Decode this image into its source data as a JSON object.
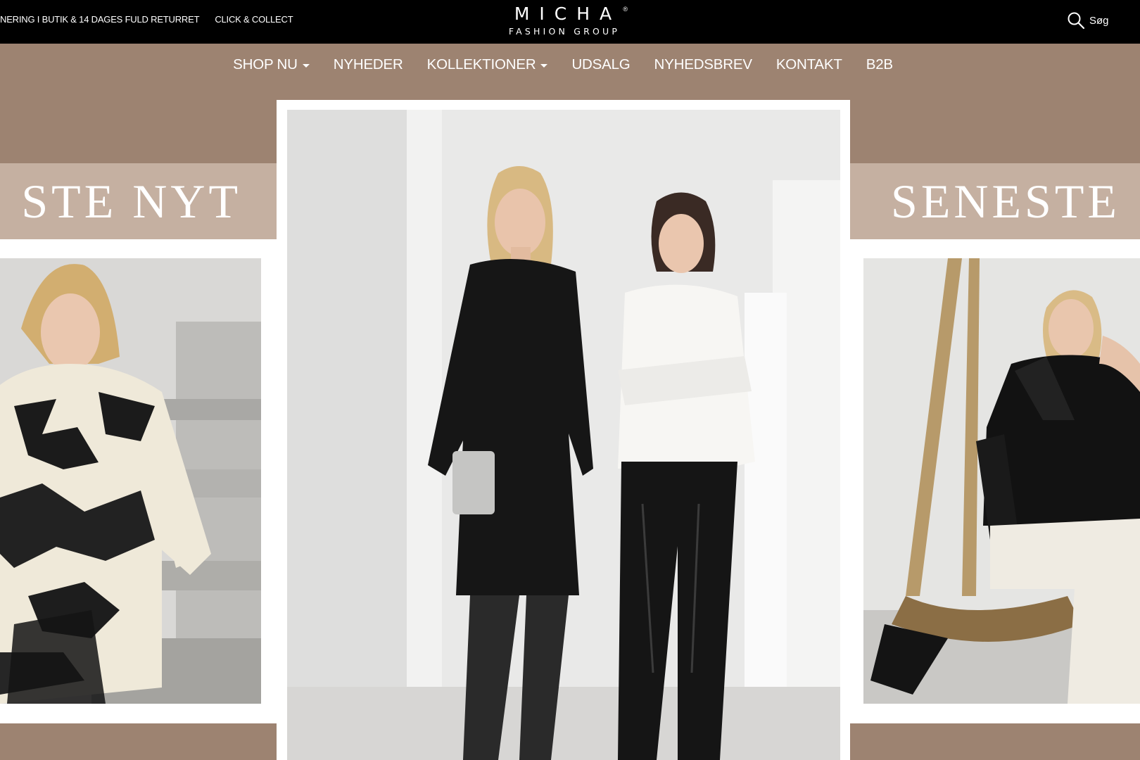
{
  "topbar": {
    "ticker": [
      "NERING I BUTIK & 14 DAGES FULD RETURRET",
      "CLICK & COLLECT"
    ],
    "search_label": "Søg",
    "search_icon": "search-icon"
  },
  "logo": {
    "word": "MICHA",
    "reg": "®",
    "sub": "FASHION GROUP"
  },
  "nav": {
    "items": [
      {
        "label": "SHOP NU",
        "dropdown": true
      },
      {
        "label": "NYHEDER",
        "dropdown": false
      },
      {
        "label": "KOLLEKTIONER",
        "dropdown": true
      },
      {
        "label": "UDSALG",
        "dropdown": false
      },
      {
        "label": "NYHEDSBREV",
        "dropdown": false
      },
      {
        "label": "KONTAKT",
        "dropdown": false
      },
      {
        "label": "B2B",
        "dropdown": false
      }
    ]
  },
  "banners": {
    "left_text": "STE NYT",
    "right_text": "SENESTE"
  },
  "colors": {
    "taupe": "#9d8371",
    "light_taupe": "#c5b0a1",
    "black": "#000000",
    "white": "#ffffff"
  }
}
